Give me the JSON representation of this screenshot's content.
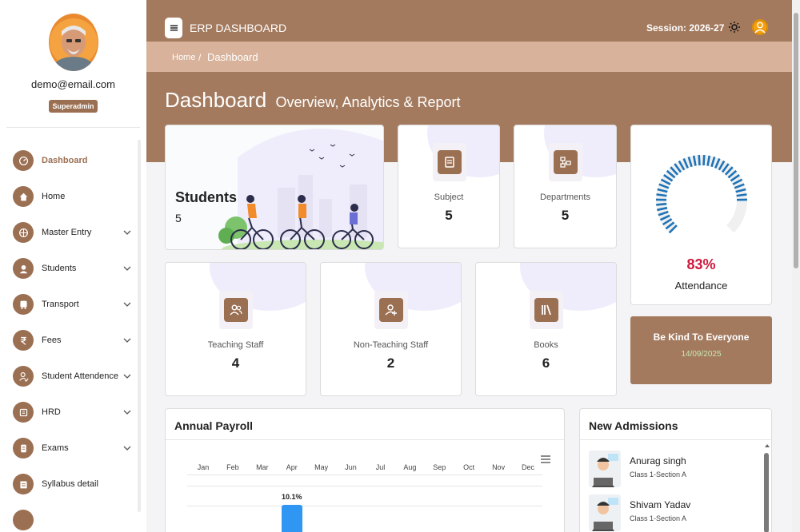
{
  "user": {
    "email": "demo@email.com",
    "role": "Superadmin"
  },
  "sidebar": {
    "items": [
      {
        "label": "Dashboard",
        "icon": "dashboard-icon",
        "active": true,
        "chevron": false
      },
      {
        "label": "Home",
        "icon": "home-icon",
        "active": false,
        "chevron": false
      },
      {
        "label": "Master Entry",
        "icon": "globe-icon",
        "active": false,
        "chevron": true
      },
      {
        "label": "Students",
        "icon": "student-icon",
        "active": false,
        "chevron": true
      },
      {
        "label": "Transport",
        "icon": "bus-icon",
        "active": false,
        "chevron": true
      },
      {
        "label": "Fees",
        "icon": "rupee-icon",
        "active": false,
        "chevron": true
      },
      {
        "label": "Student Attendence",
        "icon": "attendance-icon",
        "active": false,
        "chevron": true
      },
      {
        "label": "HRD",
        "icon": "hrd-icon",
        "active": false,
        "chevron": true
      },
      {
        "label": "Exams",
        "icon": "exam-icon",
        "active": false,
        "chevron": true
      },
      {
        "label": "Syllabus detail",
        "icon": "syllabus-icon",
        "active": false,
        "chevron": false
      }
    ]
  },
  "header": {
    "title": "ERP DASHBOARD",
    "session": "Session: 2026-27"
  },
  "breadcrumb": {
    "home": "Home",
    "separator": "/",
    "current": "Dashboard"
  },
  "page": {
    "title": "Dashboard",
    "subtitle": "Overview, Analytics & Report"
  },
  "cards": {
    "students": {
      "label": "Students",
      "value": "5"
    },
    "subject": {
      "label": "Subject",
      "value": "5"
    },
    "departments": {
      "label": "Departments",
      "value": "5"
    },
    "teaching_staff": {
      "label": "Teaching Staff",
      "value": "4"
    },
    "non_teaching_staff": {
      "label": "Non-Teaching Staff",
      "value": "2"
    },
    "books": {
      "label": "Books",
      "value": "6"
    }
  },
  "attendance": {
    "percent": "83%",
    "fraction": 0.83,
    "label": "Attendance"
  },
  "quote": {
    "text": "Be Kind To Everyone",
    "date": "14/09/2025"
  },
  "colors": {
    "primary": "#a37a5e",
    "accent": "#9b6f52",
    "gauge": "#1e73b8",
    "bar": "#2f97f3",
    "alert": "#d0183b"
  },
  "payroll": {
    "title": "Annual Payroll"
  },
  "chart_data": {
    "type": "bar",
    "categories": [
      "Jan",
      "Feb",
      "Mar",
      "Apr",
      "May",
      "Jun",
      "Jul",
      "Aug",
      "Sep",
      "Oct",
      "Nov",
      "Dec"
    ],
    "series": [
      {
        "values": [
          0,
          0,
          0,
          10.1,
          0,
          0,
          0,
          0,
          0,
          0,
          0,
          0
        ],
        "labels": [
          "",
          "",
          "",
          "10.1%",
          "",
          "",
          "",
          "",
          "",
          "",
          "",
          ""
        ]
      }
    ]
  },
  "admissions": {
    "title": "New Admissions",
    "items": [
      {
        "name": "Anurag singh",
        "class": "Class 1-Section A"
      },
      {
        "name": "Shivam Yadav",
        "class": "Class 1-Section A"
      }
    ]
  }
}
